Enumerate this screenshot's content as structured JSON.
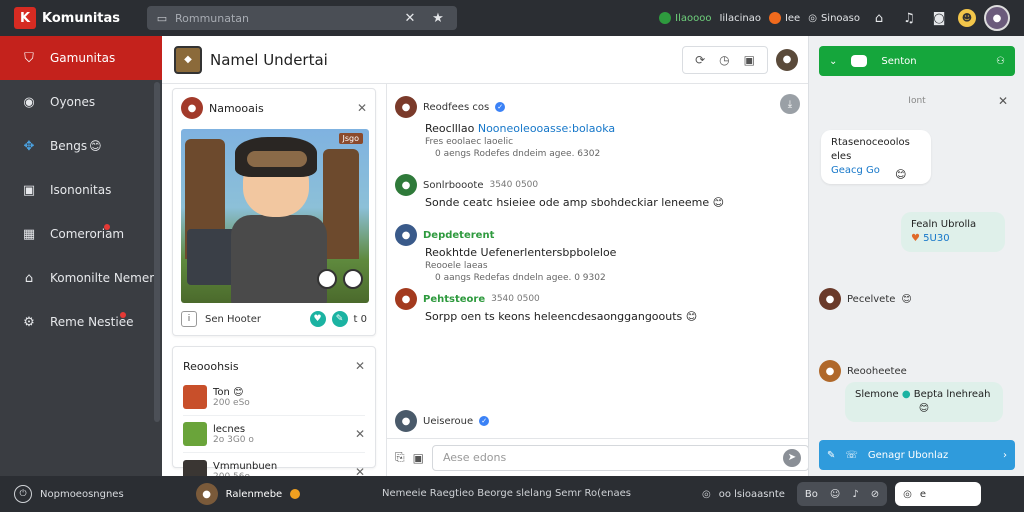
{
  "app": {
    "title": "Komunitas"
  },
  "search": {
    "placeholder": "Rommunatan"
  },
  "topbar": {
    "status_a": "Ilaoooo",
    "status_b": "Iilacinao",
    "status_c": "Iee",
    "status_d": "Sinoaso",
    "colors": {
      "green": "#2e9a3e",
      "orange": "#f06a1d"
    }
  },
  "sidebar": {
    "items": [
      {
        "label": "Gamunitas",
        "icon": "shield-icon",
        "active": true
      },
      {
        "label": "Oyones",
        "icon": "bubble-icon"
      },
      {
        "label": "Bengs",
        "emoji": "😊",
        "icon": "puzzle-icon"
      },
      {
        "label": "Isononitas",
        "icon": "record-icon"
      },
      {
        "label": "Comeroriam",
        "icon": "grid-icon"
      },
      {
        "label": "Komonilte Nemem",
        "icon": "home-icon"
      },
      {
        "label": "Reme Nestiee",
        "icon": "gear-icon"
      }
    ],
    "accent": "#c4221c"
  },
  "main": {
    "title": "Namel Undertai"
  },
  "feature_card": {
    "title": "Namooais",
    "art_tag": "Jsgo",
    "foot_label": "Sen Hooter",
    "foot_count": "t 0"
  },
  "list_card": {
    "title": "Reooohsis",
    "rows": [
      {
        "name": "Ton",
        "emoji": "😊",
        "sub": "200 eSo"
      },
      {
        "name": "lecnes",
        "sub": "2o 3G0 o"
      },
      {
        "name": "Vmmunbuen",
        "sub": "200 56o"
      }
    ]
  },
  "feed": {
    "posts": [
      {
        "name": "Reodfees cos",
        "body_prefix": "Reoclllao",
        "body_link": "Nooneoleooasse:bolaoka",
        "meta1": "Fres eoolaec laoelic",
        "meta2": "0 aengs  Rodefes dndeim agee. 6302"
      },
      {
        "name": "Sonlrbooote",
        "time": "3540 0500",
        "body": "Sonde ceatc hsieiee ode amp sbohdeckiar leneeme",
        "emoji": "😊"
      },
      {
        "name": "Depdeterent",
        "body": "Reokhtde Uefenerlentersbpboleloe",
        "meta1": "Reooele laeas",
        "meta2": "0 aangs  Redefas dndeln agee. 0 9302"
      },
      {
        "name": "Pehtsteore",
        "time": "3540 0500",
        "body": "Sorpp oen ts keons heleencdesaonggangoouts",
        "emoji": "😊"
      },
      {
        "name": "Ueiseroue"
      }
    ]
  },
  "composer": {
    "placeholder": "Aese edons"
  },
  "chat": {
    "header_label": "Senton",
    "title": "Iont",
    "msg1_line1": "Rtasenoceoolos eles",
    "msg1_line2": "Geacg Go",
    "msg2_line1": "Fealn Ubrolla",
    "msg2_line2": "5U30",
    "user1": "Pecelvete",
    "user2": "Reooheetee",
    "msg3_line1": "Slemone",
    "msg3_line2": "Bepta lnehreah",
    "cta": "Genagr Ubonlaz",
    "colors": {
      "green": "#15a63c",
      "blue": "#2f9bdc",
      "mint": "#dff0ea"
    }
  },
  "bottombar": {
    "left": "Nopmoeosngnes",
    "user": "Ralenmebe",
    "center": "Nemeeie Raegtieo Beorge slelang Semr Ro(enaes",
    "right_label": "oo lsioaasnte",
    "pill_label": "Bo",
    "white_pill_label": "e"
  }
}
